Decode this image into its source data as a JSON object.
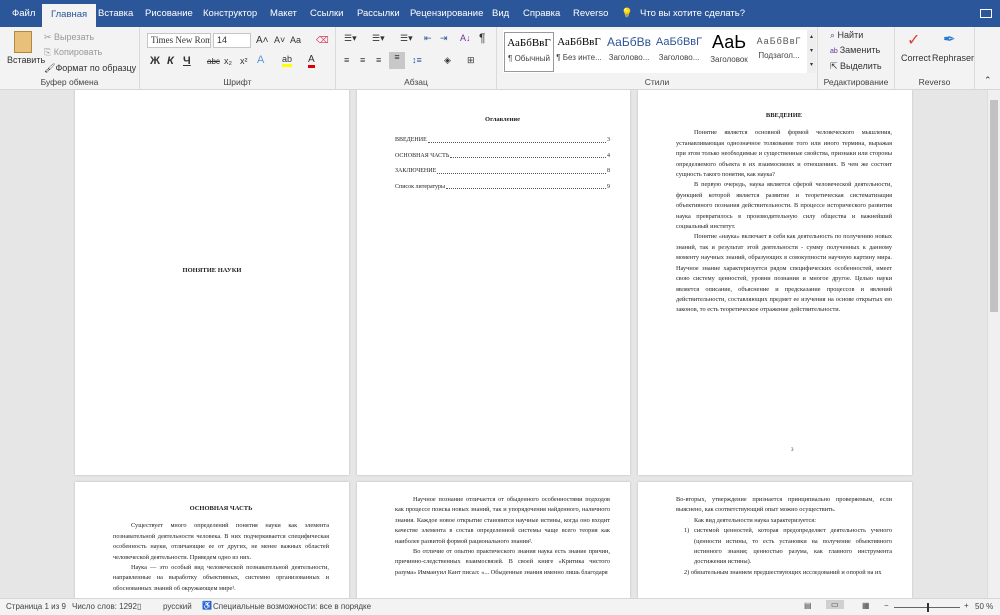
{
  "tabs": [
    "Файл",
    "Главная",
    "Вставка",
    "Рисование",
    "Конструктор",
    "Макет",
    "Ссылки",
    "Рассылки",
    "Рецензирование",
    "Вид",
    "Справка",
    "Reverso"
  ],
  "tell_me": "Что вы хотите сделать?",
  "clipboard": {
    "paste": "Вставить",
    "cut": "Вырезать",
    "copy": "Копировать",
    "format_painter": "Формат по образцу",
    "label": "Буфер обмена"
  },
  "font": {
    "name": "Times New Roman",
    "size": "14",
    "bold": "Ж",
    "italic": "К",
    "underline": "Ч",
    "strike": "abc",
    "sub": "x₂",
    "sup": "x²",
    "grow": "A˄",
    "shrink": "A˅",
    "case": "Aa",
    "label": "Шрифт"
  },
  "paragraph": {
    "label": "Абзац",
    "pilcrow": "¶"
  },
  "styles": {
    "label": "Стили",
    "items": [
      {
        "sample": "АаБбВвГ",
        "name": "¶ Обычный"
      },
      {
        "sample": "АаБбВвГ",
        "name": "¶ Без инте..."
      },
      {
        "sample": "АаБбВв",
        "name": "Заголово..."
      },
      {
        "sample": "АаБбВвГ",
        "name": "Заголово..."
      },
      {
        "sample": "АаЬ",
        "name": "Заголовок"
      },
      {
        "sample": "АаБбВвГ",
        "name": "Подзагол..."
      }
    ]
  },
  "editing": {
    "find": "Найти",
    "replace": "Заменить",
    "select": "Выделить",
    "label": "Редактирование"
  },
  "reverso": {
    "correct": "Correct",
    "rephraser": "Rephraser",
    "label": "Reverso"
  },
  "colors": {
    "brand": "#2b579a",
    "highlight": "#ffff00",
    "font_color": "#e00000"
  },
  "pages": {
    "p1": {
      "title": "ПОНЯТИЕ НАУКИ"
    },
    "p2": {
      "title": "Оглавление",
      "toc": [
        {
          "t": "ВВЕДЕНИЕ",
          "p": "3"
        },
        {
          "t": "ОСНОВНАЯ ЧАСТЬ",
          "p": "4"
        },
        {
          "t": "ЗАКЛЮЧЕНИЕ",
          "p": "8"
        },
        {
          "t": "Список литературы",
          "p": "9"
        }
      ]
    },
    "p3": {
      "title": "ВВЕДЕНИЕ",
      "paras": [
        "Понятие является основной формой человеческого мышления, устанавливающая однозначное толкование того или иного термина, выражая при этом только необходимые и существенные свойства, признаки или стороны определяемого объекта в их взаимосвязях и отношениях. В чем же состоит сущность такого понятия, как наука?",
        "В первую очередь, наука является сферой человеческой деятельности, функцией которой является развитие и теоретическая систематизация объективного познания действительности. В процессе исторического развития наука превратилось в производительную силу общества и важнейший социальный институт.",
        "Понятие «наука» включает в себя как деятельность по получению новых знаний, так и результат этой деятельности - сумму полученных к данному моменту научных знаний, образующих в совокупности научную картину мира. Научное знание характеризуется рядом специфических особенностей, имеет свою систему ценностей, уровни познания и многое другое. Целью науки является описание, объяснение и предсказание процессов и явлений действительности, составляющих предмет ее изучения на основе открытых ею законов, то есть теоретическое отражение действительности."
      ],
      "num": "3"
    },
    "p4": {
      "title": "ОСНОВНАЯ ЧАСТЬ",
      "paras": [
        "Существует много определений понятия науки как элемента познавательной деятельности человека. В них подчеркивается специфическая особенность науки, отличающие ее от других, не менее важных областей человеческой деятельности. Приведем одно из них.",
        "Наука — это особый вид человеческой познавательной деятельности, направленные на выработку объективных, системно организованных и обоснованных знаний об окружающем мире¹."
      ]
    },
    "p5": {
      "paras": [
        "Научное познание отличается от обыденного особенностями подходов как процессе поиска новых знаний, так и упорядочения найденного, наличного знания. Каждое новое открытие становится научные истины, когда оно входит качестве элемента в состав определенной системы чаще всего теория как наиболее развитой формой рационального знания².",
        "Во отличие от опытно практического знания наука есть знание причин, причинно-следственных взаимосвязей. В своей книге «Критика чистого разума» Иммануил Кант писал: «... Обыденные знания именно лишь благодаря"
      ]
    },
    "p6": {
      "lead": "Во-вторых, утверждение признается принципиально проверяемым, если выяснено, как соответствующий опыт можно осуществить.",
      "intro": "Как вид деятельности наука характеризуется:",
      "items": [
        "1) системой ценностей, которая предопределяет деятельность ученого (ценности истины, то есть установки на получение объективного истинного знания; ценностью разума, как главного инструмента достижения истины).",
        "2) обязательным знанием предшествующих исследований и опорой на их"
      ]
    }
  },
  "status": {
    "page": "Страница 1 из 9",
    "words": "Число слов: 1292",
    "lang": "русский",
    "accessibility": "Специальные возможности: все в порядке",
    "zoom": "50 %",
    "zoom_level": 0.5
  }
}
